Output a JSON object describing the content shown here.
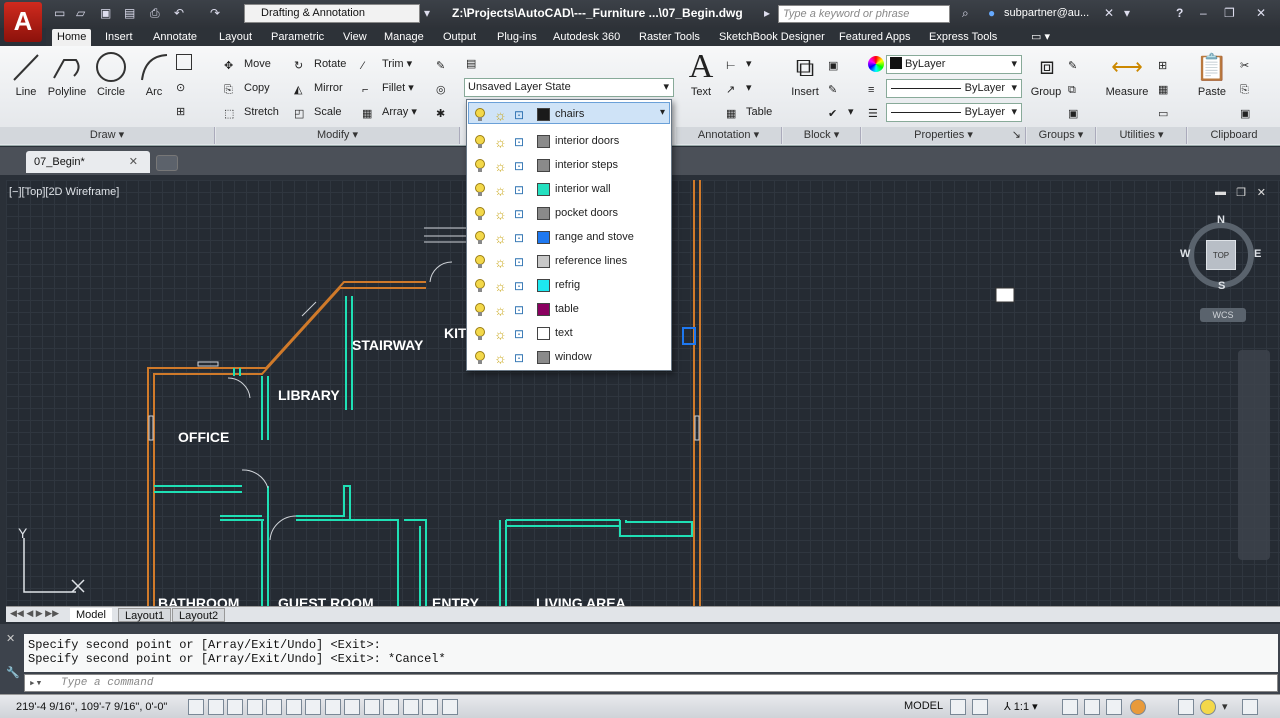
{
  "title_bar": {
    "app_letter": "A",
    "workspace": "Drafting & Annotation",
    "filename": "Z:\\Projects\\AutoCAD\\---_Furniture ...\\07_Begin.dwg",
    "search_placeholder": "Type a keyword or phrase",
    "username": "subpartner@au..."
  },
  "ribbon_tabs": [
    "Home",
    "Insert",
    "Annotate",
    "Layout",
    "Parametric",
    "View",
    "Manage",
    "Output",
    "Plug-ins",
    "Autodesk 360",
    "Raster Tools",
    "SketchBook Designer",
    "Featured Apps",
    "Express Tools"
  ],
  "active_tab": "Home",
  "draw_panel": {
    "title": "Draw",
    "line": "Line",
    "polyline": "Polyline",
    "circle": "Circle",
    "arc": "Arc"
  },
  "modify_panel": {
    "title": "Modify",
    "move": "Move",
    "rotate": "Rotate",
    "trim": "Trim",
    "copy": "Copy",
    "mirror": "Mirror",
    "fillet": "Fillet",
    "stretch": "Stretch",
    "scale": "Scale",
    "array": "Array"
  },
  "layers_panel": {
    "layer_state": "Unsaved Layer State",
    "current_layer": "chairs"
  },
  "annotation_panel": {
    "title": "Annotation",
    "text": "Text",
    "table": "Table"
  },
  "block_panel": {
    "title": "Block",
    "insert": "Insert"
  },
  "properties_panel": {
    "title": "Properties",
    "color": "ByLayer",
    "linetype": "ByLayer",
    "lineweight": "ByLayer"
  },
  "groups_panel": {
    "title": "Groups",
    "group": "Group"
  },
  "utilities_panel": {
    "title": "Utilities",
    "measure": "Measure"
  },
  "clipboard_panel": {
    "title": "Clipboard",
    "paste": "Paste"
  },
  "document_tab": "07_Begin*",
  "viewport_label": "[−][Top][2D Wireframe]",
  "layers": [
    {
      "name": "chairs",
      "color": "#1a1a1a"
    },
    {
      "name": "interior doors",
      "color": "#8a8a8a"
    },
    {
      "name": "interior steps",
      "color": "#8a8a8a"
    },
    {
      "name": "interior wall",
      "color": "#24e0c0"
    },
    {
      "name": "pocket doors",
      "color": "#8a8a8a"
    },
    {
      "name": "range and stove",
      "color": "#1e78f0"
    },
    {
      "name": "reference lines",
      "color": "#c8c8c8"
    },
    {
      "name": "refrig",
      "color": "#1ee8f0"
    },
    {
      "name": "table",
      "color": "#8a0060"
    },
    {
      "name": "text",
      "color": "#ffffff"
    },
    {
      "name": "window",
      "color": "#8a8a8a"
    }
  ],
  "floorplan_labels": {
    "stairway": "STAIRWAY",
    "kitchen": "KIT",
    "library": "LIBRARY",
    "office": "OFFICE",
    "bathroom": "BATHROOM",
    "guest": "GUEST ROOM",
    "entry": "ENTRY",
    "living": "LIVING AREA"
  },
  "viewcube": {
    "n": "N",
    "s": "S",
    "e": "E",
    "w": "W",
    "face": "TOP",
    "ucs": "WCS"
  },
  "ucs_icon": {
    "y": "Y"
  },
  "layout_tabs": [
    "Model",
    "Layout1",
    "Layout2"
  ],
  "command_history": [
    "Specify second point or [Array/Exit/Undo] <Exit>:",
    "Specify second point or [Array/Exit/Undo] <Exit>: *Cancel*"
  ],
  "command_placeholder": "Type a command",
  "status": {
    "coords": "219'-4 9/16\", 109'-7 9/16\", 0'-0\"",
    "space": "MODEL",
    "scale": "1:1"
  }
}
